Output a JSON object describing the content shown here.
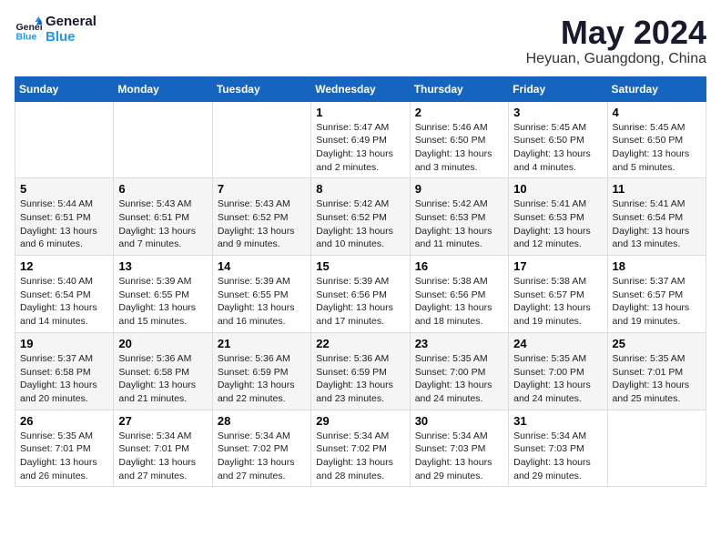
{
  "header": {
    "logo_line1": "General",
    "logo_line2": "Blue",
    "title": "May 2024",
    "subtitle": "Heyuan, Guangdong, China"
  },
  "weekdays": [
    "Sunday",
    "Monday",
    "Tuesday",
    "Wednesday",
    "Thursday",
    "Friday",
    "Saturday"
  ],
  "weeks": [
    [
      {
        "day": "",
        "sunrise": "",
        "sunset": "",
        "daylight": ""
      },
      {
        "day": "",
        "sunrise": "",
        "sunset": "",
        "daylight": ""
      },
      {
        "day": "",
        "sunrise": "",
        "sunset": "",
        "daylight": ""
      },
      {
        "day": "1",
        "sunrise": "Sunrise: 5:47 AM",
        "sunset": "Sunset: 6:49 PM",
        "daylight": "Daylight: 13 hours and 2 minutes."
      },
      {
        "day": "2",
        "sunrise": "Sunrise: 5:46 AM",
        "sunset": "Sunset: 6:50 PM",
        "daylight": "Daylight: 13 hours and 3 minutes."
      },
      {
        "day": "3",
        "sunrise": "Sunrise: 5:45 AM",
        "sunset": "Sunset: 6:50 PM",
        "daylight": "Daylight: 13 hours and 4 minutes."
      },
      {
        "day": "4",
        "sunrise": "Sunrise: 5:45 AM",
        "sunset": "Sunset: 6:50 PM",
        "daylight": "Daylight: 13 hours and 5 minutes."
      }
    ],
    [
      {
        "day": "5",
        "sunrise": "Sunrise: 5:44 AM",
        "sunset": "Sunset: 6:51 PM",
        "daylight": "Daylight: 13 hours and 6 minutes."
      },
      {
        "day": "6",
        "sunrise": "Sunrise: 5:43 AM",
        "sunset": "Sunset: 6:51 PM",
        "daylight": "Daylight: 13 hours and 7 minutes."
      },
      {
        "day": "7",
        "sunrise": "Sunrise: 5:43 AM",
        "sunset": "Sunset: 6:52 PM",
        "daylight": "Daylight: 13 hours and 9 minutes."
      },
      {
        "day": "8",
        "sunrise": "Sunrise: 5:42 AM",
        "sunset": "Sunset: 6:52 PM",
        "daylight": "Daylight: 13 hours and 10 minutes."
      },
      {
        "day": "9",
        "sunrise": "Sunrise: 5:42 AM",
        "sunset": "Sunset: 6:53 PM",
        "daylight": "Daylight: 13 hours and 11 minutes."
      },
      {
        "day": "10",
        "sunrise": "Sunrise: 5:41 AM",
        "sunset": "Sunset: 6:53 PM",
        "daylight": "Daylight: 13 hours and 12 minutes."
      },
      {
        "day": "11",
        "sunrise": "Sunrise: 5:41 AM",
        "sunset": "Sunset: 6:54 PM",
        "daylight": "Daylight: 13 hours and 13 minutes."
      }
    ],
    [
      {
        "day": "12",
        "sunrise": "Sunrise: 5:40 AM",
        "sunset": "Sunset: 6:54 PM",
        "daylight": "Daylight: 13 hours and 14 minutes."
      },
      {
        "day": "13",
        "sunrise": "Sunrise: 5:39 AM",
        "sunset": "Sunset: 6:55 PM",
        "daylight": "Daylight: 13 hours and 15 minutes."
      },
      {
        "day": "14",
        "sunrise": "Sunrise: 5:39 AM",
        "sunset": "Sunset: 6:55 PM",
        "daylight": "Daylight: 13 hours and 16 minutes."
      },
      {
        "day": "15",
        "sunrise": "Sunrise: 5:39 AM",
        "sunset": "Sunset: 6:56 PM",
        "daylight": "Daylight: 13 hours and 17 minutes."
      },
      {
        "day": "16",
        "sunrise": "Sunrise: 5:38 AM",
        "sunset": "Sunset: 6:56 PM",
        "daylight": "Daylight: 13 hours and 18 minutes."
      },
      {
        "day": "17",
        "sunrise": "Sunrise: 5:38 AM",
        "sunset": "Sunset: 6:57 PM",
        "daylight": "Daylight: 13 hours and 19 minutes."
      },
      {
        "day": "18",
        "sunrise": "Sunrise: 5:37 AM",
        "sunset": "Sunset: 6:57 PM",
        "daylight": "Daylight: 13 hours and 19 minutes."
      }
    ],
    [
      {
        "day": "19",
        "sunrise": "Sunrise: 5:37 AM",
        "sunset": "Sunset: 6:58 PM",
        "daylight": "Daylight: 13 hours and 20 minutes."
      },
      {
        "day": "20",
        "sunrise": "Sunrise: 5:36 AM",
        "sunset": "Sunset: 6:58 PM",
        "daylight": "Daylight: 13 hours and 21 minutes."
      },
      {
        "day": "21",
        "sunrise": "Sunrise: 5:36 AM",
        "sunset": "Sunset: 6:59 PM",
        "daylight": "Daylight: 13 hours and 22 minutes."
      },
      {
        "day": "22",
        "sunrise": "Sunrise: 5:36 AM",
        "sunset": "Sunset: 6:59 PM",
        "daylight": "Daylight: 13 hours and 23 minutes."
      },
      {
        "day": "23",
        "sunrise": "Sunrise: 5:35 AM",
        "sunset": "Sunset: 7:00 PM",
        "daylight": "Daylight: 13 hours and 24 minutes."
      },
      {
        "day": "24",
        "sunrise": "Sunrise: 5:35 AM",
        "sunset": "Sunset: 7:00 PM",
        "daylight": "Daylight: 13 hours and 24 minutes."
      },
      {
        "day": "25",
        "sunrise": "Sunrise: 5:35 AM",
        "sunset": "Sunset: 7:01 PM",
        "daylight": "Daylight: 13 hours and 25 minutes."
      }
    ],
    [
      {
        "day": "26",
        "sunrise": "Sunrise: 5:35 AM",
        "sunset": "Sunset: 7:01 PM",
        "daylight": "Daylight: 13 hours and 26 minutes."
      },
      {
        "day": "27",
        "sunrise": "Sunrise: 5:34 AM",
        "sunset": "Sunset: 7:01 PM",
        "daylight": "Daylight: 13 hours and 27 minutes."
      },
      {
        "day": "28",
        "sunrise": "Sunrise: 5:34 AM",
        "sunset": "Sunset: 7:02 PM",
        "daylight": "Daylight: 13 hours and 27 minutes."
      },
      {
        "day": "29",
        "sunrise": "Sunrise: 5:34 AM",
        "sunset": "Sunset: 7:02 PM",
        "daylight": "Daylight: 13 hours and 28 minutes."
      },
      {
        "day": "30",
        "sunrise": "Sunrise: 5:34 AM",
        "sunset": "Sunset: 7:03 PM",
        "daylight": "Daylight: 13 hours and 29 minutes."
      },
      {
        "day": "31",
        "sunrise": "Sunrise: 5:34 AM",
        "sunset": "Sunset: 7:03 PM",
        "daylight": "Daylight: 13 hours and 29 minutes."
      },
      {
        "day": "",
        "sunrise": "",
        "sunset": "",
        "daylight": ""
      }
    ]
  ]
}
